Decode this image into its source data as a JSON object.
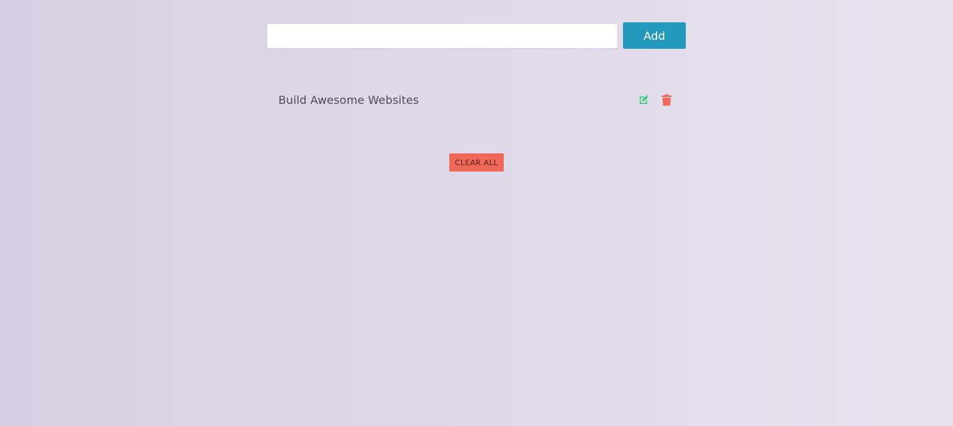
{
  "form": {
    "input_value": "",
    "input_placeholder": "",
    "add_label": "Add"
  },
  "tasks": [
    {
      "label": "Build Awesome Websites",
      "edit_icon": "edit-icon",
      "delete_icon": "trash-icon"
    }
  ],
  "actions": {
    "clear_label": "CLEAR ALL"
  },
  "colors": {
    "accent": "#2299bd",
    "edit": "#2ecc71",
    "delete": "#f0685a"
  }
}
